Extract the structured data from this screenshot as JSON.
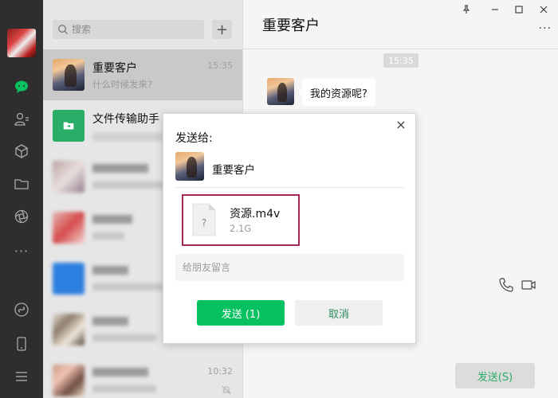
{
  "window": {
    "pin_icon": "pin-icon",
    "minimize_icon": "minimize-icon",
    "maximize_icon": "maximize-icon",
    "close_icon": "close-icon"
  },
  "nav": {
    "items": [
      "chat-icon",
      "contacts-icon",
      "cube-icon",
      "folder-icon",
      "moments-icon",
      "more-icon",
      "mini-program-icon",
      "phone-icon",
      "menu-icon"
    ],
    "active_color": "#07c160"
  },
  "search": {
    "placeholder": "搜索",
    "add_label": "+"
  },
  "sessions": [
    {
      "name": "重要客户",
      "last_message": "什么时候发来?",
      "time": "15:35",
      "active": true
    },
    {
      "name": "文件传输助手",
      "last_message": "",
      "time": "",
      "active": false
    },
    {
      "name": "",
      "last_message": "",
      "time": "",
      "blurred": true
    },
    {
      "name": "",
      "last_message": "",
      "time": "",
      "blurred": true
    },
    {
      "name": "",
      "last_message": "",
      "time": "",
      "blurred": true
    },
    {
      "name": "",
      "last_message": "",
      "time": "",
      "blurred": true
    },
    {
      "name": "",
      "last_message": "",
      "time": "10:32",
      "blurred": true
    }
  ],
  "chat": {
    "title": "重要客户",
    "more_label": "···",
    "timestamp": "15:35",
    "messages": [
      {
        "from": "contact",
        "text": "我的资源呢?"
      }
    ],
    "send_label": "发送(S)"
  },
  "dialog": {
    "title": "发送给:",
    "recipient": "重要客户",
    "file": {
      "name": "资源.m4v",
      "size": "2.1G",
      "icon_glyph": "?"
    },
    "message_placeholder": "给朋友留言",
    "send_label": "发送 (1)",
    "cancel_label": "取消",
    "close_label": "×"
  }
}
